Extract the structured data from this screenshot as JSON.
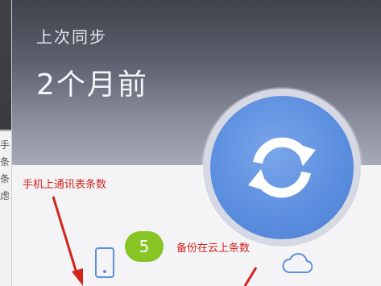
{
  "background": {
    "partial_chars": [
      "手",
      "条",
      "条",
      "虑"
    ]
  },
  "sync_panel": {
    "title": "上次同步",
    "last_sync": "2个月前",
    "sync_icon": "refresh-icon",
    "phone_icon": "phone-icon",
    "cloud_icon": "cloud-icon",
    "count": "5"
  },
  "annotations": {
    "phone_count_label": "手机上通讯表条数",
    "cloud_count_label": "备份在云上条数",
    "color": "#d2231c"
  },
  "colors": {
    "accent_blue": "#5c8fdf",
    "badge_green": "#86c524"
  }
}
